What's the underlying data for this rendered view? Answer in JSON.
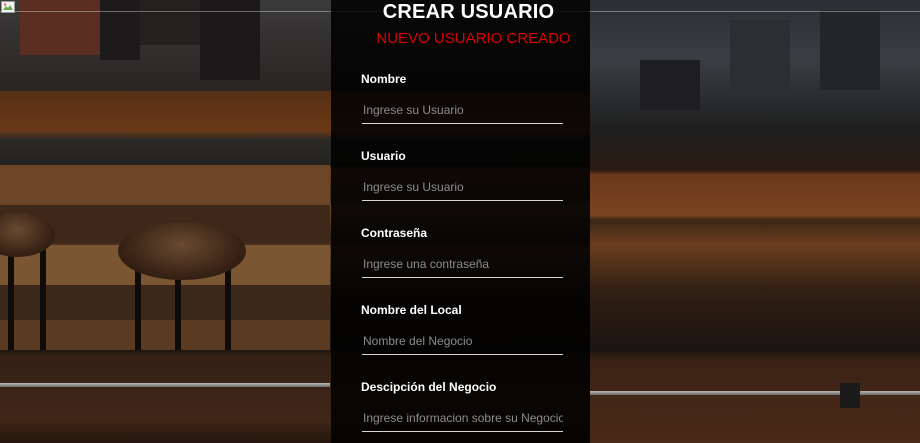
{
  "form": {
    "title": "CREAR USUARIO",
    "status_message": "NUEVO USUARIO CREADO",
    "fields": [
      {
        "label": "Nombre",
        "placeholder": "Ingrese su Usuario",
        "value": ""
      },
      {
        "label": "Usuario",
        "placeholder": "Ingrese su Usuario",
        "value": ""
      },
      {
        "label": "Contraseña",
        "placeholder": "Ingrese una contraseña",
        "value": ""
      },
      {
        "label": "Nombre del Local",
        "placeholder": "Nombre del Negocio",
        "value": ""
      },
      {
        "label": "Descipción del Negocio",
        "placeholder": "Ingrese informacion sobre su Negocio",
        "value": ""
      }
    ]
  },
  "colors": {
    "status": "#e00000",
    "title": "#ffffff",
    "panel_overlay": "rgba(0,0,0,0.86)"
  },
  "icons": {
    "header_image": "broken-image-icon"
  }
}
